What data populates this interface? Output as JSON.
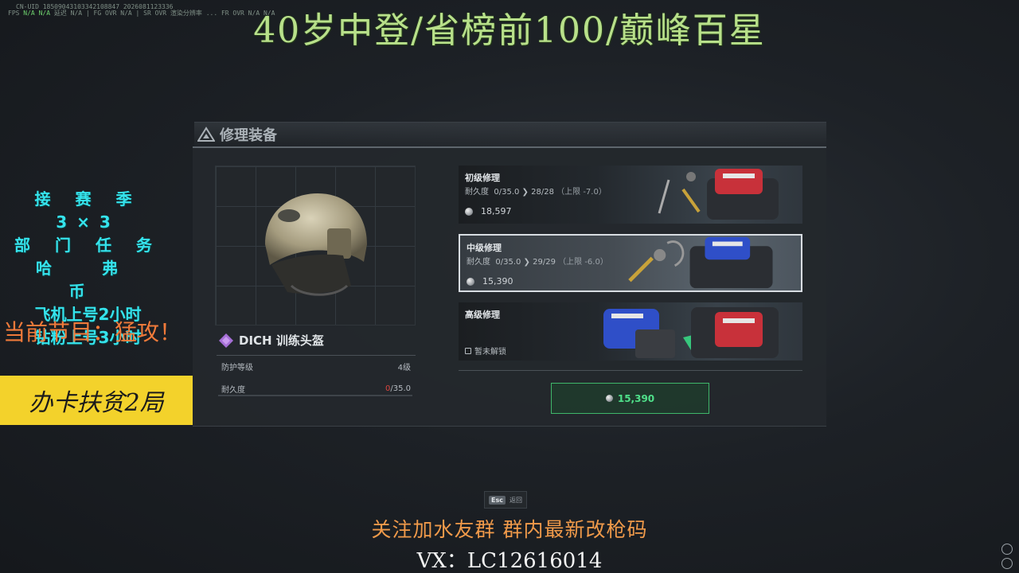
{
  "overlay": {
    "debug_line1": "CN-UID 18509043103342108847  2026081123336",
    "debug_fps_label": "FPS",
    "debug_fps_value": "N/A",
    "debug_na": "N/A",
    "debug_line2_rest": "延迟 N/A | FG OVR N/A | SR OVR 渲染分辨率 ... FR OVR N/A N/A",
    "stream_title": "40岁中登/省榜前100/巅峰百星",
    "left_lines": [
      "接 赛 季 3×3",
      "部 门 任 务",
      "哈 弗 币",
      "飞机上号2小时",
      "钻粉上号3小时"
    ],
    "program": "当前节目：猛攻！",
    "banner": "办卡扶贫2局",
    "footer1": "关注加水友群 群内最新改枪码",
    "footer2": "VX：LC12616014"
  },
  "panel": {
    "title": "修理装备",
    "item": {
      "name": "DICH 训练头盔",
      "stats": [
        {
          "label": "防护等级",
          "value": "4级"
        },
        {
          "label": "耐久度",
          "current": "0",
          "max": "/35.0"
        }
      ],
      "durability_fraction": 0
    },
    "options": [
      {
        "name": "初级修理",
        "dur_label": "耐久度",
        "dur_from": "0/35.0",
        "dur_to": "28/28",
        "limit": "（上限 -7.0）",
        "cost": "18,597",
        "locked": false,
        "selected": false
      },
      {
        "name": "中级修理",
        "dur_label": "耐久度",
        "dur_from": "0/35.0",
        "dur_to": "29/29",
        "limit": "（上限 -6.0）",
        "cost": "15,390",
        "locked": false,
        "selected": true
      },
      {
        "name": "高级修理",
        "lock_text": "暂未解锁",
        "locked": true,
        "selected": false
      }
    ],
    "confirm_cost": "15,390",
    "esc_key": "Esc",
    "esc_label": "返回"
  },
  "colors": {
    "title_green": "#b8e08a",
    "left_cyan": "#35e3ec",
    "program_orange": "#f07a3a",
    "banner_yellow": "#f3d22b",
    "confirm_green": "#4fe08a",
    "durability_red": "#d9453f"
  }
}
